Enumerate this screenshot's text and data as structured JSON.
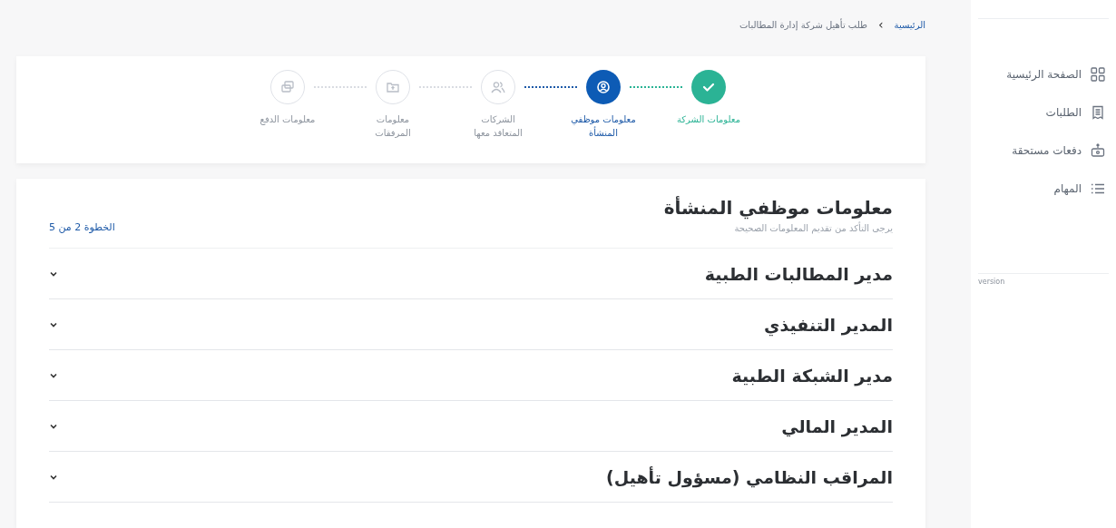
{
  "breadcrumb": {
    "home": "الرئيسية",
    "separator": "›",
    "current": "طلب تأهيل شركة إدارة المطالبات"
  },
  "steps": [
    {
      "label": "معلومات الشركة",
      "kind": "done"
    },
    {
      "label": "معلومات موظفي المنشأة",
      "kind": "active"
    },
    {
      "label": "الشركات المتعاقد معها",
      "kind": "pending"
    },
    {
      "label": "معلومات المرفقات",
      "kind": "pending"
    },
    {
      "label": "معلومات الدفع",
      "kind": "pending"
    }
  ],
  "section": {
    "title": "معلومات موظفي المنشأة",
    "subtitle": "يرجى التأكد من تقديم المعلومات الصحيحة",
    "step_counter": "الخطوة 2 من 5"
  },
  "accordions": [
    {
      "title": "مدير المطالبات الطبية",
      "expanded": false
    },
    {
      "title": "المدير التنفيذي",
      "expanded": false
    },
    {
      "title": "مدير الشبكة الطبية",
      "expanded": false
    },
    {
      "title": "المدير المالي",
      "expanded": false
    },
    {
      "title": "المراقب النظامي (مسؤول تأهيل)",
      "expanded": false
    }
  ],
  "sidebar": {
    "items": [
      {
        "label": "الصفحة الرئيسية"
      },
      {
        "label": "الطلبات"
      },
      {
        "label": "دفعات مستحقة"
      },
      {
        "label": "المهام"
      }
    ],
    "version": "version"
  }
}
